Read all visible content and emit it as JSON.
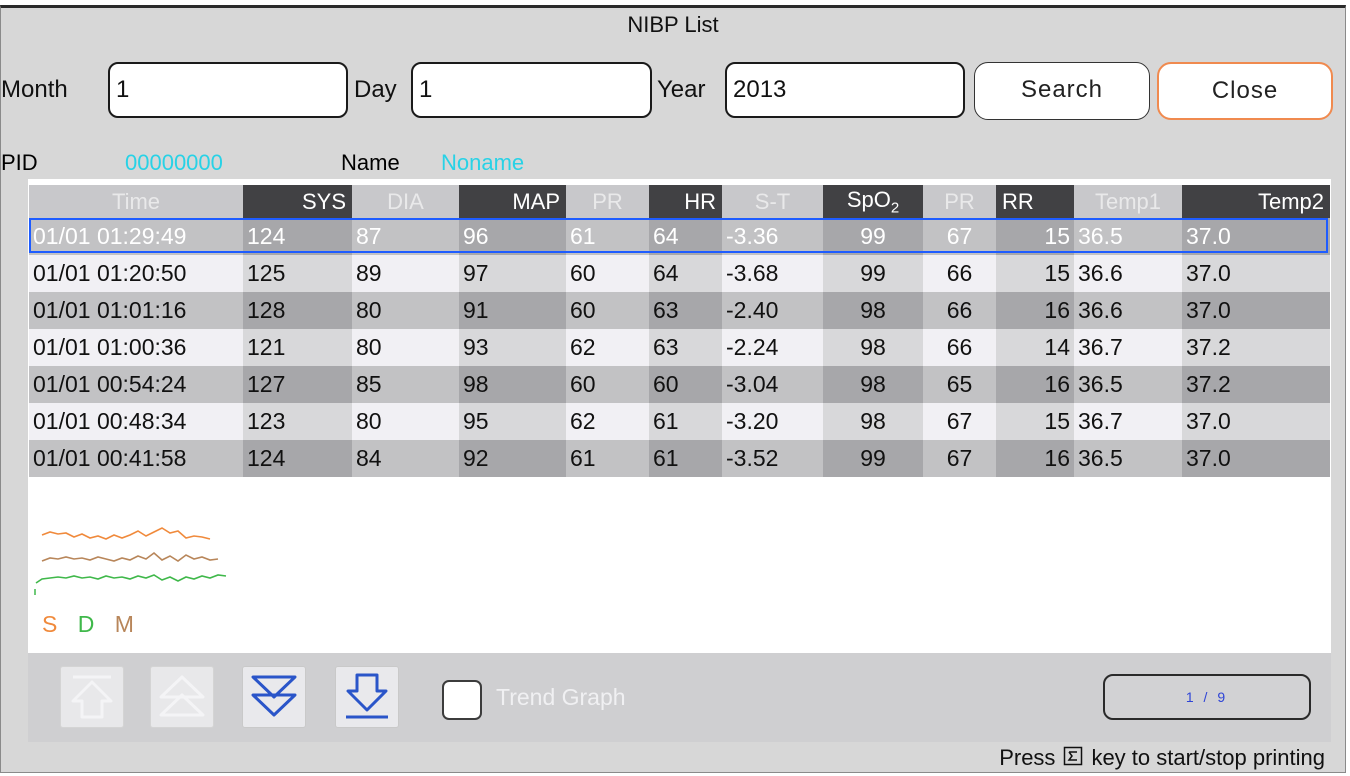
{
  "window": {
    "title": "NIBP List"
  },
  "search": {
    "month_label": "Month",
    "month_value": "1",
    "day_label": "Day",
    "day_value": "1",
    "year_label": "Year",
    "year_value": "2013",
    "search_label": "Search",
    "close_label": "Close"
  },
  "patient": {
    "pid_label": "PID",
    "pid_value": "00000000",
    "name_label": "Name",
    "name_value": "Noname"
  },
  "table": {
    "headers": [
      "Time",
      "SYS",
      "DIA",
      "MAP",
      "PR",
      "HR",
      "S-T",
      "SpO",
      "PR",
      "RR",
      "Temp1",
      "Temp2"
    ],
    "spo2_subscript": "2",
    "rows": [
      [
        "01/01 01:29:49",
        "124",
        "87",
        "96",
        "61",
        "64",
        "-3.36",
        "99",
        "67",
        "15",
        "36.5",
        "37.0"
      ],
      [
        "01/01 01:20:50",
        "125",
        "89",
        "97",
        "60",
        "64",
        "-3.68",
        "99",
        "66",
        "15",
        "36.6",
        "37.0"
      ],
      [
        "01/01 01:01:16",
        "128",
        "80",
        "91",
        "60",
        "63",
        "-2.40",
        "98",
        "66",
        "16",
        "36.6",
        "37.0"
      ],
      [
        "01/01 01:00:36",
        "121",
        "80",
        "93",
        "62",
        "63",
        "-2.24",
        "98",
        "66",
        "14",
        "36.7",
        "37.2"
      ],
      [
        "01/01 00:54:24",
        "127",
        "85",
        "98",
        "60",
        "60",
        "-3.04",
        "98",
        "65",
        "16",
        "36.5",
        "37.2"
      ],
      [
        "01/01 00:48:34",
        "123",
        "80",
        "95",
        "62",
        "61",
        "-3.20",
        "98",
        "67",
        "15",
        "36.7",
        "37.0"
      ],
      [
        "01/01 00:41:58",
        "124",
        "84",
        "92",
        "61",
        "61",
        "-3.52",
        "99",
        "67",
        "16",
        "36.5",
        "37.0"
      ]
    ],
    "selected_row": 0
  },
  "trend_legend": {
    "s": "S",
    "d": "D",
    "m": "M",
    "s_color": "#f08a3c",
    "d_color": "#3fb84a",
    "m_color": "#b8865a"
  },
  "bottom": {
    "trend_graph_label": "Trend Graph",
    "page_indicator": "1 / 9",
    "icons": [
      "page-up-icon",
      "scroll-up-icon",
      "scroll-down-icon",
      "page-down-icon"
    ]
  },
  "status": {
    "press": "Press",
    "rest": "key to start/stop printing"
  }
}
